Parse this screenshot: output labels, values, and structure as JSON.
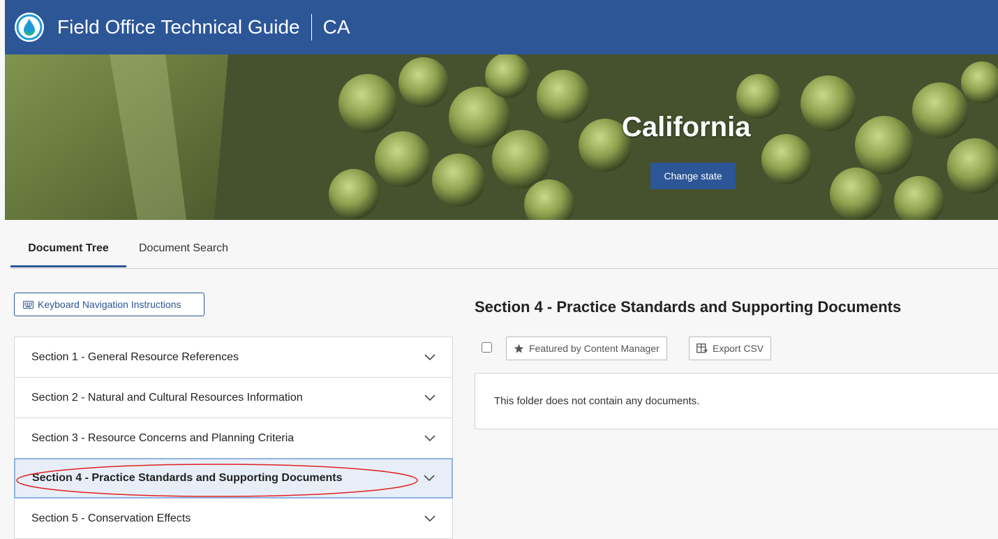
{
  "header": {
    "app_title": "Field Office Technical Guide",
    "state_code": "CA",
    "logo": "water-drop-logo-icon",
    "background_color": "#2c5696"
  },
  "hero": {
    "state_name": "California",
    "change_state_label": "Change state"
  },
  "tabs": [
    {
      "label": "Document Tree",
      "active": true
    },
    {
      "label": "Document Search",
      "active": false
    }
  ],
  "keyboard_nav": {
    "label": "Keyboard Navigation Instructions",
    "icon": "keyboard-icon"
  },
  "accordion": [
    {
      "label": "Section 1 - General Resource References",
      "selected": false
    },
    {
      "label": "Section 2 - Natural and Cultural Resources Information",
      "selected": false
    },
    {
      "label": "Section 3 - Resource Concerns and Planning Criteria",
      "selected": false
    },
    {
      "label": "Section 4 - Practice Standards and Supporting Documents",
      "selected": true
    },
    {
      "label": "Section 5 - Conservation Effects",
      "selected": false
    }
  ],
  "content": {
    "heading": "Section 4 - Practice Standards and Supporting Documents",
    "featured_label": "Featured by Content Manager",
    "export_label": "Export CSV",
    "empty_message": "This folder does not contain any documents."
  },
  "colors": {
    "accent": "#2c5696",
    "selected_row_bg": "#e8eef8",
    "annotation_red": "#e0201e"
  }
}
